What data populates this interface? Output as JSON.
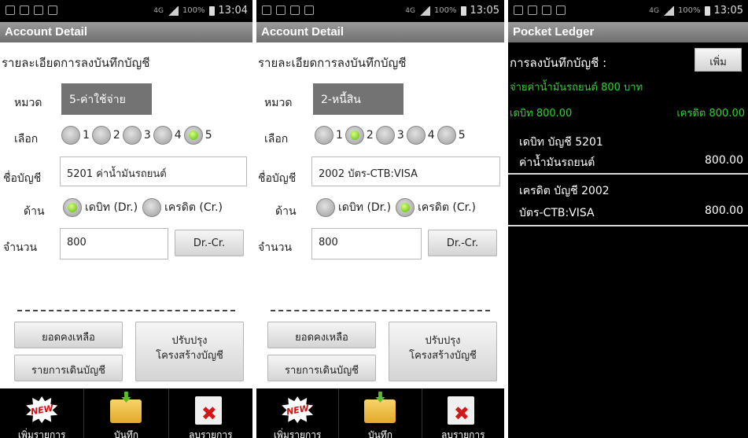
{
  "statusbar": {
    "network": "4G",
    "battery": "100%"
  },
  "panels": [
    {
      "time": "13:04",
      "title": "Account Detail",
      "heading": "รายละเอียดการลงบันทึกบัญชี",
      "category_label": "หมวด",
      "category_value": "5-ค่าใช้จ่าย",
      "select_label": "เลือก",
      "select_options": [
        "1",
        "2",
        "3",
        "4",
        "5"
      ],
      "selected": "5",
      "account_label": "ชื่อบัญชี",
      "account_value": "5201 ค่าน้ำมันรถยนต์",
      "side_label": "ด้าน",
      "debit_label": "เดบิท (Dr.)",
      "credit_label": "เครดิต (Cr.)",
      "side_selected": "debit",
      "amount_label": "จำนวน",
      "amount_value": "800",
      "drcr_button": "Dr.-Cr.",
      "balance_button": "ยอดคงเหลือ",
      "movement_button": "รายการเดินบัญชี",
      "adjust_button_line1": "ปรับปรุง",
      "adjust_button_line2": "โครงสร้างบัญชี",
      "nav": [
        "เพิ่มรายการ",
        "บันทึก",
        "ลบรายการ"
      ],
      "new_badge": "NEW"
    },
    {
      "time": "13:05",
      "title": "Account Detail",
      "heading": "รายละเอียดการลงบันทึกบัญชี",
      "category_label": "หมวด",
      "category_value": "2-หนี้สิน",
      "select_label": "เลือก",
      "select_options": [
        "1",
        "2",
        "3",
        "4",
        "5"
      ],
      "selected": "2",
      "account_label": "ชื่อบัญชี",
      "account_value": "2002 บัตร-CTB:VISA",
      "side_label": "ด้าน",
      "debit_label": "เดบิท (Dr.)",
      "credit_label": "เครดิต (Cr.)",
      "side_selected": "credit",
      "amount_label": "จำนวน",
      "amount_value": "800",
      "drcr_button": "Dr.-Cr.",
      "balance_button": "ยอดคงเหลือ",
      "movement_button": "รายการเดินบัญชี",
      "adjust_button_line1": "ปรับปรุง",
      "adjust_button_line2": "โครงสร้างบัญชี",
      "nav": [
        "เพิ่มรายการ",
        "บันทึก",
        "ลบรายการ"
      ],
      "new_badge": "NEW"
    }
  ],
  "ledger": {
    "time": "13:05",
    "title": "Pocket Ledger",
    "heading": "การลงบันทึกบัญชี :",
    "add_button": "เพิ่ม",
    "description": "จ่ายค่าน้ำมันรถยนต์  800 บาท",
    "debit_total": "เดบิท 800.00",
    "credit_total": "เครดิต 800.00",
    "entries": [
      {
        "line1": "เดบิท   บัญชี  5201",
        "line2": "ค่าน้ำมันรถยนต์",
        "amount": "800.00"
      },
      {
        "line1": "เครดิต  บัญชี  2002",
        "line2": "บัตร-CTB:VISA",
        "amount": "800.00"
      }
    ]
  },
  "colors": {
    "accent_green": "#2fd12f",
    "titlebar": "#808080",
    "category_box": "#737373"
  }
}
